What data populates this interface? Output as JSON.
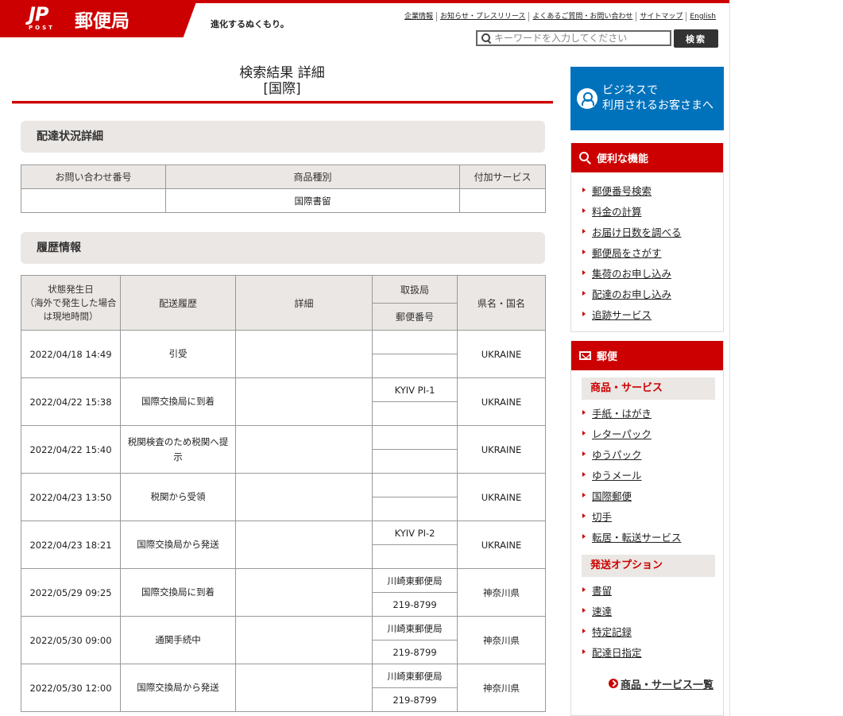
{
  "header": {
    "logo_mark": "JP",
    "logo_sub": "POST",
    "logo_name": "郵便局",
    "tagline": "進化するぬくもり。",
    "links": [
      "企業情報",
      "お知らせ・プレスリリース",
      "よくあるご質問・お問い合わせ",
      "サイトマップ",
      "English"
    ],
    "search_placeholder": "キーワードを入力してください",
    "search_button": "検索"
  },
  "title": {
    "line1": "検索結果 詳細",
    "line2": "[国際]"
  },
  "delivery_detail": {
    "heading": "配達状況詳細",
    "columns": [
      "お問い合わせ番号",
      "商品種別",
      "付加サービス"
    ],
    "row": [
      "",
      "国際書留",
      ""
    ]
  },
  "history": {
    "heading": "履歴情報",
    "col_date": "状態発生日\n（海外で発生した場合は現地時間）",
    "col_status": "配送履歴",
    "col_detail": "詳細",
    "col_office": "取扱局",
    "col_postal": "郵便番号",
    "col_region": "県名・国名",
    "rows": [
      {
        "date": "2022/04/18 14:49",
        "status": "引受",
        "detail": "",
        "office": "",
        "postal": "",
        "region": "UKRAINE"
      },
      {
        "date": "2022/04/22 15:38",
        "status": "国際交換局に到着",
        "detail": "",
        "office": "KYIV PI-1",
        "postal": "",
        "region": "UKRAINE"
      },
      {
        "date": "2022/04/22 15:40",
        "status": "税関検査のため税関へ提示",
        "detail": "",
        "office": "",
        "postal": "",
        "region": "UKRAINE"
      },
      {
        "date": "2022/04/23 13:50",
        "status": "税関から受領",
        "detail": "",
        "office": "",
        "postal": "",
        "region": "UKRAINE"
      },
      {
        "date": "2022/04/23 18:21",
        "status": "国際交換局から発送",
        "detail": "",
        "office": "KYIV PI-2",
        "postal": "",
        "region": "UKRAINE"
      },
      {
        "date": "2022/05/29 09:25",
        "status": "国際交換局に到着",
        "detail": "",
        "office": "川崎東郵便局",
        "postal": "219-8799",
        "region": "神奈川県"
      },
      {
        "date": "2022/05/30 09:00",
        "status": "通関手続中",
        "detail": "",
        "office": "川崎東郵便局",
        "postal": "219-8799",
        "region": "神奈川県"
      },
      {
        "date": "2022/05/30 12:00",
        "status": "国際交換局から発送",
        "detail": "",
        "office": "川崎東郵便局",
        "postal": "219-8799",
        "region": "神奈川県"
      }
    ]
  },
  "sidebar": {
    "business_banner": "ビジネスで\n利用されるお客さまへ",
    "features": {
      "heading": "便利な機能",
      "items": [
        "郵便番号検索",
        "料金の計算",
        "お届け日数を調べる",
        "郵便局をさがす",
        "集荷のお申し込み",
        "配達のお申し込み",
        "追跡サービス"
      ]
    },
    "mail": {
      "heading": "郵便",
      "products_heading": "商品・サービス",
      "products": [
        "手紙・はがき",
        "レターパック",
        "ゆうパック",
        "ゆうメール",
        "国際郵便",
        "切手",
        "転居・転送サービス"
      ],
      "options_heading": "発送オプション",
      "options": [
        "書留",
        "速達",
        "特定記録",
        "配達日指定"
      ],
      "more_link": "商品・サービス一覧"
    }
  },
  "colors": {
    "brand_red": "#cc0000",
    "business_blue": "#0072bc",
    "section_gray": "#ebe7e4"
  }
}
